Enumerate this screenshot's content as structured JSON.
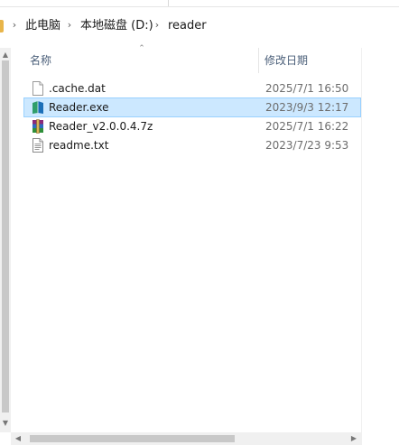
{
  "breadcrumb": {
    "items": [
      {
        "label": "此电脑"
      },
      {
        "label": "本地磁盘 (D:)"
      },
      {
        "label": "reader"
      }
    ]
  },
  "columns": {
    "name": "名称",
    "date": "修改日期"
  },
  "files": [
    {
      "name": ".cache.dat",
      "date": "2025/7/1 16:50",
      "icon": "document-icon",
      "selected": false
    },
    {
      "name": "Reader.exe",
      "date": "2023/9/3 12:17",
      "icon": "book-app-icon",
      "selected": true
    },
    {
      "name": "Reader_v2.0.0.4.7z",
      "date": "2025/7/1 16:22",
      "icon": "archive-icon",
      "selected": false
    },
    {
      "name": "readme.txt",
      "date": "2023/7/23 9:53",
      "icon": "text-file-icon",
      "selected": false
    }
  ],
  "colors": {
    "selection_bg": "#cce8ff",
    "selection_border": "#99d1ff",
    "header_text": "#4c607a",
    "date_text": "#6d6d6d"
  }
}
